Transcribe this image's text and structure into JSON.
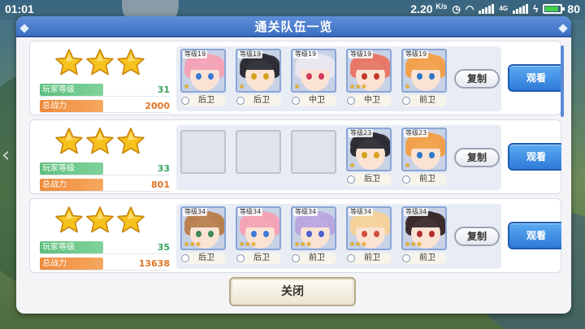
{
  "status_bar": {
    "time": "01:01",
    "speed": "2.20",
    "speed_unit": "K/s",
    "network": "4G",
    "battery": "80"
  },
  "dialog": {
    "title": "通关队伍一览",
    "close_label": "关闭",
    "copy_label": "复制",
    "view_label": "观看",
    "player_level_label": "玩家等级",
    "power_label": "总战力"
  },
  "teams": [
    {
      "stars": 3,
      "player_level": "31",
      "power": "2000",
      "members": [
        {
          "level": "等级19",
          "position": "后卫",
          "hair": "#f3a3b6",
          "eye": "#3b7bd6",
          "rarity": 1
        },
        {
          "level": "等级19",
          "position": "后卫",
          "hair": "#2d2d36",
          "eye": "#d4a31f",
          "rarity": 1
        },
        {
          "level": "等级19",
          "position": "中卫",
          "hair": "#e9e6ef",
          "eye": "#d23a5e",
          "rarity": 1
        },
        {
          "level": "等级19",
          "position": "中卫",
          "hair": "#e77868",
          "eye": "#c0392b",
          "rarity": 3
        },
        {
          "level": "等级19",
          "position": "前卫",
          "hair": "#f0a04b",
          "eye": "#2f77c8",
          "rarity": 1
        }
      ]
    },
    {
      "stars": 3,
      "player_level": "33",
      "power": "801",
      "members": [
        {
          "level": "等级23",
          "position": "后卫",
          "hair": "#2d2d36",
          "eye": "#d4a31f",
          "rarity": 1
        },
        {
          "level": "等级23",
          "position": "前卫",
          "hair": "#f0a04b",
          "eye": "#2f77c8",
          "rarity": 1
        }
      ]
    },
    {
      "stars": 3,
      "player_level": "35",
      "power": "13638",
      "members": [
        {
          "level": "等级34",
          "position": "后卫",
          "hair": "#b7804f",
          "eye": "#3d8a55",
          "rarity": 3
        },
        {
          "level": "等级34",
          "position": "后卫",
          "hair": "#f3a3b6",
          "eye": "#3b7bd6",
          "rarity": 3
        },
        {
          "level": "等级34",
          "position": "前卫",
          "hair": "#b9a6e0",
          "eye": "#4d5fd1",
          "rarity": 3
        },
        {
          "level": "等级34",
          "position": "前卫",
          "hair": "#f3d29a",
          "eye": "#d04e3c",
          "rarity": 3
        },
        {
          "level": "等级34",
          "position": "前卫",
          "hair": "#3a2a2a",
          "eye": "#b12d2d",
          "rarity": 3
        }
      ]
    }
  ]
}
